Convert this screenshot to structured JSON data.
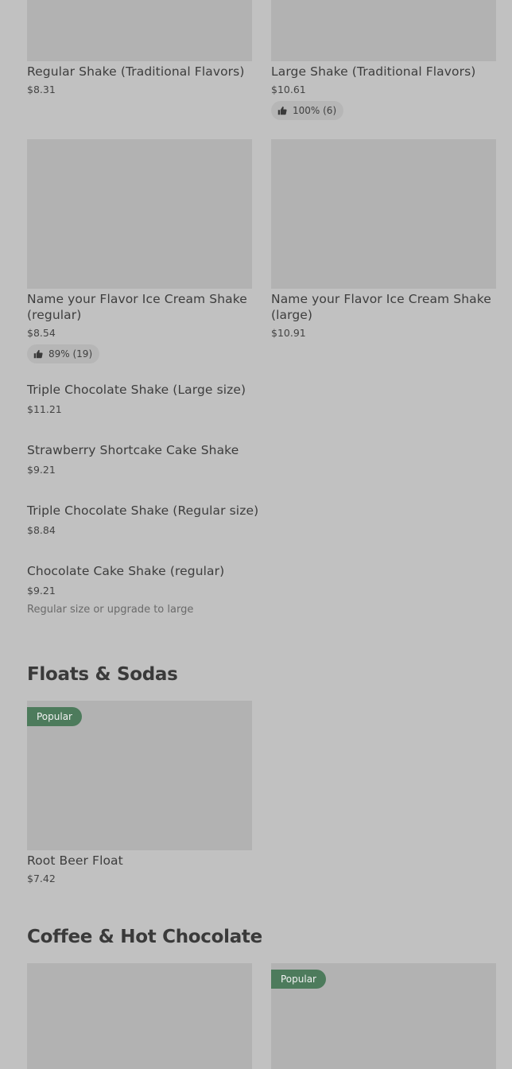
{
  "items": {
    "regular_shake": {
      "title": "Regular Shake (Traditional Flavors)",
      "price": "$8.31"
    },
    "large_shake": {
      "title": "Large Shake (Traditional Flavors)",
      "price": "$10.61",
      "rating": "100% (6)"
    },
    "nyf_regular": {
      "title_line1": "Name your Flavor Ice Cream Shake",
      "title_line2": "(regular)",
      "price": "$8.54",
      "rating": "89% (19)"
    },
    "nyf_large": {
      "title_line1": "Name your Flavor Ice Cream Shake",
      "title_line2": "(large)",
      "price": "$10.91"
    },
    "triple_choc_large": {
      "title": "Triple Chocolate Shake (Large size)",
      "price": "$11.21"
    },
    "strawberry_shortcake": {
      "title": "Strawberry Shortcake Cake Shake",
      "price": "$9.21"
    },
    "triple_choc_regular": {
      "title": "Triple Chocolate Shake (Regular size)",
      "price": "$8.84"
    },
    "choc_cake_regular": {
      "title": "Chocolate Cake Shake (regular)",
      "price": "$9.21",
      "description": "Regular size or upgrade to large"
    },
    "root_beer_float": {
      "title": "Root Beer Float",
      "price": "$7.42",
      "badge": "Popular"
    },
    "coffee_item_2": {
      "badge": "Popular"
    }
  },
  "sections": {
    "floats_sodas": "Floats & Sodas",
    "coffee_hot_chocolate": "Coffee & Hot Chocolate"
  },
  "colors": {
    "background": "#c1c1c1",
    "image_placeholder": "#b2b2b2",
    "popular_badge": "#4d7b5c",
    "rating_pill": "#b6b6b6"
  },
  "icons": {
    "rating": "thumbs-up-icon"
  }
}
